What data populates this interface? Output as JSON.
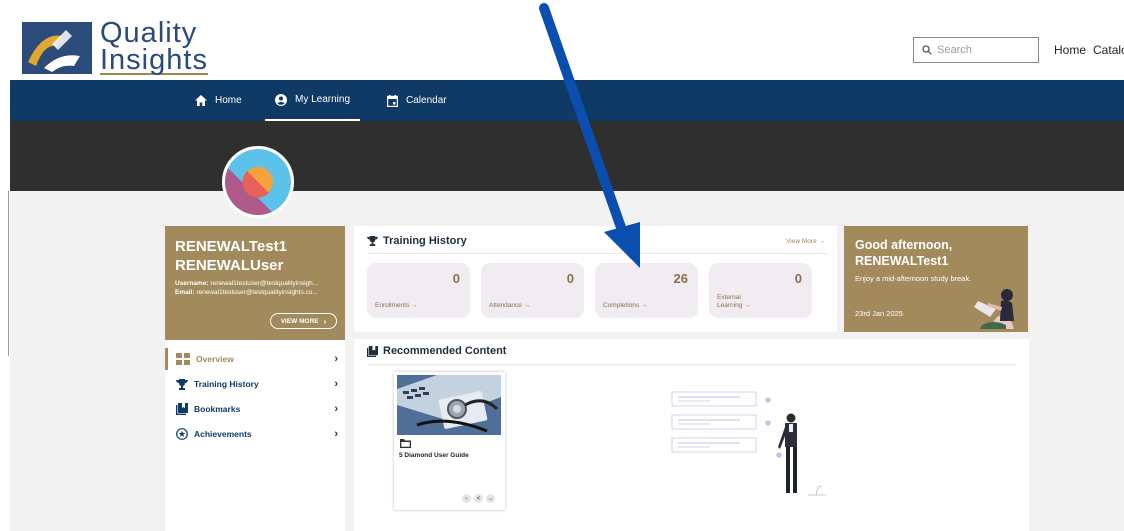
{
  "header": {
    "logo_line1": "Quality",
    "logo_line2": "Insights",
    "search_placeholder": "Search",
    "links": [
      "Home",
      "Catalog"
    ]
  },
  "nav": {
    "home": "Home",
    "my_learning": "My Learning",
    "calendar": "Calendar"
  },
  "profile": {
    "first": "RENEWALTest1",
    "last": "RENEWALUser",
    "username_label": "Username:",
    "username": "renewal1testuser@testqualityinsigh...",
    "email_label": "Email:",
    "email": "renewal1testuser@testqualityinsights.co...",
    "view_more": "VIEW MORE"
  },
  "sidebar": {
    "items": [
      {
        "label": "Overview",
        "icon": "overview-icon"
      },
      {
        "label": "Training History",
        "icon": "trophy-icon"
      },
      {
        "label": "Bookmarks",
        "icon": "bookmark-icon"
      },
      {
        "label": "Achievements",
        "icon": "star-icon"
      }
    ]
  },
  "training_history": {
    "title": "Training History",
    "view_more": "View More →",
    "stats": [
      {
        "value": "0",
        "label": "Enrollments →"
      },
      {
        "value": "0",
        "label": "Attendance →"
      },
      {
        "value": "26",
        "label": "Completions →"
      },
      {
        "value": "0",
        "label_line1": "External",
        "label_line2": "Learning →"
      }
    ]
  },
  "greeting": {
    "line1": "Good afternoon,",
    "line2": "RENEWALTest1",
    "message": "Enjoy a mid-afternoon study break.",
    "date": "23rd Jan 2025"
  },
  "recommended": {
    "title": "Recommended Content",
    "card_title": "5 Diamond User Guide"
  },
  "colors": {
    "navy": "#0f3a66",
    "gold": "#a38a5c",
    "arrow": "#0a4fb0"
  }
}
